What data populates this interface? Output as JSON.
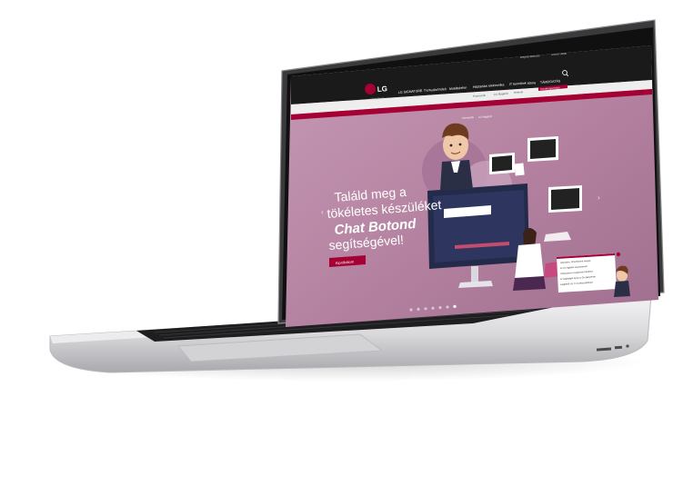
{
  "site": {
    "brand": "LG",
    "brand_tagline": "Life's Good",
    "top_links": [
      "Bejelentkezés",
      "Üzleti oldal"
    ],
    "nav_items": [
      "LG SIGNATURE",
      "TV/Audio/Videó",
      "Mobiltelefon",
      "Háztartási elektronika",
      "IT termékek",
      "Klíma",
      "TÁMOGATÁS"
    ],
    "promo_items": [
      "Promóciók",
      "LG Magazin",
      "Hírlevél",
      "Termékregisztráció"
    ],
    "breadcrumb": "Home › Támogatás › Kapcsolat › Chat Botond",
    "subnav_items": [
      "Promóciók",
      "LG Magazin"
    ]
  },
  "hero": {
    "title_lines": [
      "Találd meg a",
      "tökéletes készüléket"
    ],
    "title_bold": "Chat Botond",
    "title_end": "segítségével!",
    "cta_label": "Kipróbálom",
    "carousel_dots": 7,
    "active_dot": 6
  },
  "chat": {
    "bubble_lines": [
      "Üdvözlöm, Chat Botond vagyok,",
      "az LG digitális asszisztense!",
      "Válaszaimon 5 egyszerű kérdésre",
      "az segítséget nyújt az Ön igényeinek",
      "megfelelő LG TV kiválasztásában!"
    ]
  },
  "colors": {
    "hero_bg": "#b98aa8",
    "brand_red": "#a50034",
    "header_dark": "#1a1a1a",
    "laptop_silver": "#dcdcde"
  }
}
